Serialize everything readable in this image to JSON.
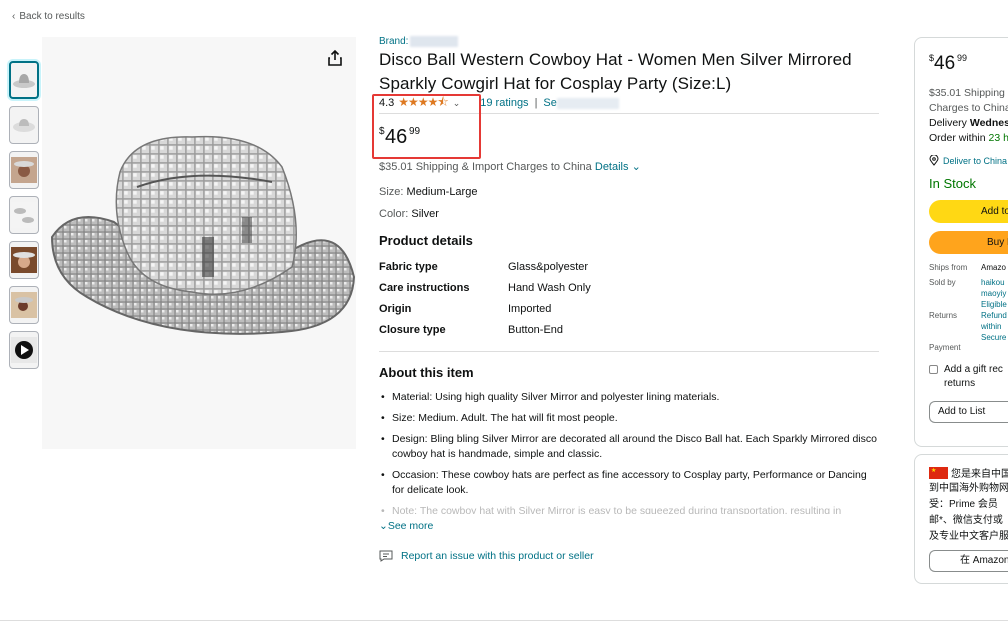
{
  "nav": {
    "back_label": "Back to results"
  },
  "product": {
    "brand_label": "Brand:",
    "title": "Disco Ball Western Cowboy Hat - Women Men Silver Mirrored Sparkly Cowgirl Hat for Cosplay Party (Size:L)",
    "rating_value": "4.3",
    "stars": "★★★★⯪",
    "ratings_count": "19 ratings",
    "search_label": "Se",
    "price": {
      "symbol": "$",
      "whole": "46",
      "fraction": "99"
    },
    "shipping_text": "$35.01 Shipping & Import Charges to China",
    "shipping_details": "Details",
    "size_label": "Size:",
    "size_value": "Medium-Large",
    "color_label": "Color:",
    "color_value": "Silver"
  },
  "product_details": {
    "heading": "Product details",
    "rows": [
      {
        "key": "Fabric type",
        "value": "Glass&polyester"
      },
      {
        "key": "Care instructions",
        "value": "Hand Wash Only"
      },
      {
        "key": "Origin",
        "value": "Imported"
      },
      {
        "key": "Closure type",
        "value": "Button-End"
      }
    ]
  },
  "about": {
    "heading": "About this item",
    "bullets": [
      "Material: Using high quality Silver Mirror and polyester lining materials.",
      "Size: Medium. Adult. The hat will fit most people.",
      "Design: Bling bling Silver Mirror are decorated all around the Disco Ball hat. Each Sparkly Mirrored disco cowboy hat is handmade, simple and classic.",
      "Occasion: These cowboy hats are perfect as fine accessory to Cosplay party, Performance or Dancing for delicate look.",
      "Note: The cowboy hat with Silver Mirror is easy to be squeezed during transportation, resulting in"
    ],
    "see_more": "See more",
    "report": "Report an issue with this product or seller"
  },
  "buybox": {
    "price": {
      "symbol": "$",
      "whole": "46",
      "fraction": "99"
    },
    "shipping_line1": "$35.01 Shipping",
    "shipping_line2": "Charges to China",
    "delivery_prefix": "Delivery ",
    "delivery_day": "Wednes",
    "order_prefix": "Order within ",
    "order_time": "23 h",
    "deliver_to": "Deliver to China",
    "stock": "In Stock",
    "add_to_cart": "Add to",
    "buy_now": "Buy N",
    "ships_from_label": "Ships from",
    "ships_from_value": "Amazo",
    "sold_by_label": "Sold by",
    "sold_by_value_1": "haikou",
    "sold_by_value_2": "maoyiy",
    "returns_label": "Returns",
    "returns_value_1": "Eligible",
    "returns_value_2": "Refund",
    "returns_value_3": "within",
    "payment_label": "Payment",
    "payment_value": "Secure",
    "gift_line1": "Add a gift rec",
    "gift_line2": "returns",
    "add_to_list": "Add to List"
  },
  "china_box": {
    "line1": "您是来自中国",
    "line2": "到中国海外购物网",
    "line3": "受：Prime 会员",
    "line4": "邮*、微信支付或",
    "line5": "及专业中文客户服",
    "button": "在 Amazon"
  },
  "colors": {
    "link": "#007185",
    "star": "#de7921",
    "green": "#007600",
    "cart_button": "#ffd814",
    "buy_button": "#ffa41c",
    "highlight": "#e53935"
  }
}
